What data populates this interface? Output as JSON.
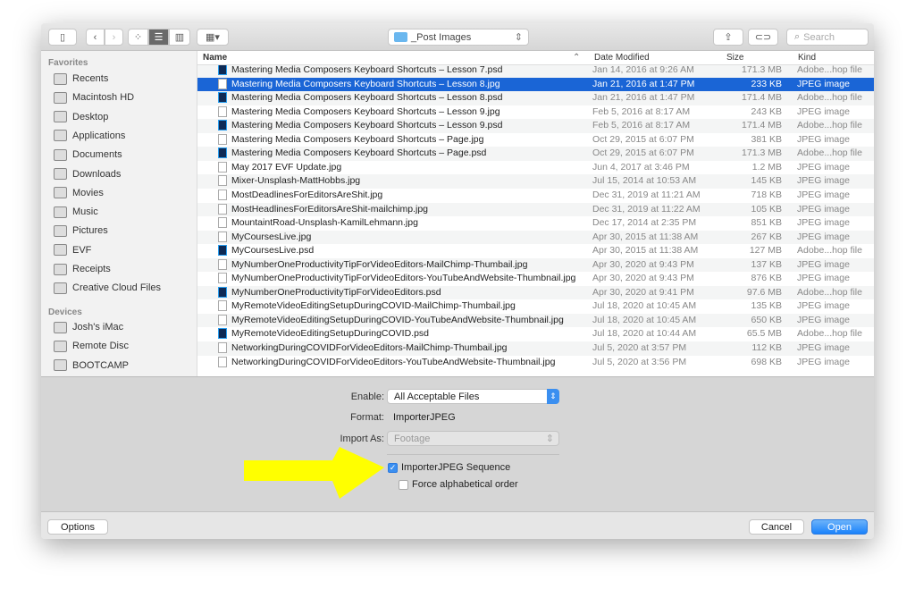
{
  "toolbar": {
    "path": "_Post Images",
    "search_placeholder": "Search"
  },
  "sidebar": {
    "favorites_header": "Favorites",
    "favorites": [
      "Recents",
      "Macintosh HD",
      "Desktop",
      "Applications",
      "Documents",
      "Downloads",
      "Movies",
      "Music",
      "Pictures",
      "EVF",
      "Receipts",
      "Creative Cloud Files"
    ],
    "devices_header": "Devices",
    "devices": [
      "Josh's iMac",
      "Remote Disc",
      "BOOTCAMP"
    ]
  },
  "columns": {
    "name": "Name",
    "date": "Date Modified",
    "size": "Size",
    "kind": "Kind"
  },
  "files": [
    [
      "Mastering Media Composers Keyboard Shortcuts – Lesson 7.psd",
      "Jan 14, 2016 at 9:26 AM",
      "171.3 MB",
      "Adobe...hop file",
      "psd"
    ],
    [
      "Mastering Media Composers Keyboard Shortcuts – Lesson 8.jpg",
      "Jan 21, 2016 at 1:47 PM",
      "233 KB",
      "JPEG image",
      "jpg"
    ],
    [
      "Mastering Media Composers Keyboard Shortcuts – Lesson 8.psd",
      "Jan 21, 2016 at 1:47 PM",
      "171.4 MB",
      "Adobe...hop file",
      "psd"
    ],
    [
      "Mastering Media Composers Keyboard Shortcuts – Lesson 9.jpg",
      "Feb 5, 2016 at 8:17 AM",
      "243 KB",
      "JPEG image",
      "jpg"
    ],
    [
      "Mastering Media Composers Keyboard Shortcuts – Lesson 9.psd",
      "Feb 5, 2016 at 8:17 AM",
      "171.4 MB",
      "Adobe...hop file",
      "psd"
    ],
    [
      "Mastering Media Composers Keyboard Shortcuts – Page.jpg",
      "Oct 29, 2015 at 6:07 PM",
      "381 KB",
      "JPEG image",
      "jpg"
    ],
    [
      "Mastering Media Composers Keyboard Shortcuts – Page.psd",
      "Oct 29, 2015 at 6:07 PM",
      "171.3 MB",
      "Adobe...hop file",
      "psd"
    ],
    [
      "May 2017 EVF Update.jpg",
      "Jun 4, 2017 at 3:46 PM",
      "1.2 MB",
      "JPEG image",
      "jpg"
    ],
    [
      "Mixer-Unsplash-MattHobbs.jpg",
      "Jul 15, 2014 at 10:53 AM",
      "145 KB",
      "JPEG image",
      "jpg"
    ],
    [
      "MostDeadlinesForEditorsAreShit.jpg",
      "Dec 31, 2019 at 11:21 AM",
      "718 KB",
      "JPEG image",
      "jpg"
    ],
    [
      "MostHeadlinesForEditorsAreShit-mailchimp.jpg",
      "Dec 31, 2019 at 11:22 AM",
      "105 KB",
      "JPEG image",
      "jpg"
    ],
    [
      "MountaintRoad-Unsplash-KamilLehmann.jpg",
      "Dec 17, 2014 at 2:35 PM",
      "851 KB",
      "JPEG image",
      "jpg"
    ],
    [
      "MyCoursesLive.jpg",
      "Apr 30, 2015 at 11:38 AM",
      "267 KB",
      "JPEG image",
      "jpg"
    ],
    [
      "MyCoursesLive.psd",
      "Apr 30, 2015 at 11:38 AM",
      "127 MB",
      "Adobe...hop file",
      "psd"
    ],
    [
      "MyNumberOneProductivityTipForVideoEditors-MailChimp-Thumbail.jpg",
      "Apr 30, 2020 at 9:43 PM",
      "137 KB",
      "JPEG image",
      "jpg"
    ],
    [
      "MyNumberOneProductivityTipForVideoEditors-YouTubeAndWebsite-Thumbnail.jpg",
      "Apr 30, 2020 at 9:43 PM",
      "876 KB",
      "JPEG image",
      "jpg"
    ],
    [
      "MyNumberOneProductivityTipForVideoEditors.psd",
      "Apr 30, 2020 at 9:41 PM",
      "97.6 MB",
      "Adobe...hop file",
      "psd"
    ],
    [
      "MyRemoteVideoEditingSetupDuringCOVID-MailChimp-Thumbail.jpg",
      "Jul 18, 2020 at 10:45 AM",
      "135 KB",
      "JPEG image",
      "jpg"
    ],
    [
      "MyRemoteVideoEditingSetupDuringCOVID-YouTubeAndWebsite-Thumbnail.jpg",
      "Jul 18, 2020 at 10:45 AM",
      "650 KB",
      "JPEG image",
      "jpg"
    ],
    [
      "MyRemoteVideoEditingSetupDuringCOVID.psd",
      "Jul 18, 2020 at 10:44 AM",
      "65.5 MB",
      "Adobe...hop file",
      "psd"
    ],
    [
      "NetworkingDuringCOVIDForVideoEditors-MailChimp-Thumbail.jpg",
      "Jul 5, 2020 at 3:57 PM",
      "112 KB",
      "JPEG image",
      "jpg"
    ],
    [
      "NetworkingDuringCOVIDForVideoEditors-YouTubeAndWebsite-Thumbnail.jpg",
      "Jul 5, 2020 at 3:56 PM",
      "698 KB",
      "JPEG image",
      "jpg"
    ]
  ],
  "selected_index": 1,
  "options": {
    "enable_label": "Enable:",
    "enable_value": "All Acceptable Files",
    "format_label": "Format:",
    "format_value": "ImporterJPEG",
    "import_as_label": "Import As:",
    "import_as_value": "Footage",
    "sequence_label": "ImporterJPEG Sequence",
    "sequence_checked": true,
    "alpha_label": "Force alphabetical order",
    "alpha_checked": false
  },
  "footer": {
    "options": "Options",
    "cancel": "Cancel",
    "open": "Open"
  },
  "colors": {
    "selection": "#1a65d6",
    "accent": "#3b8ff0",
    "arrow": "#ffff00"
  }
}
